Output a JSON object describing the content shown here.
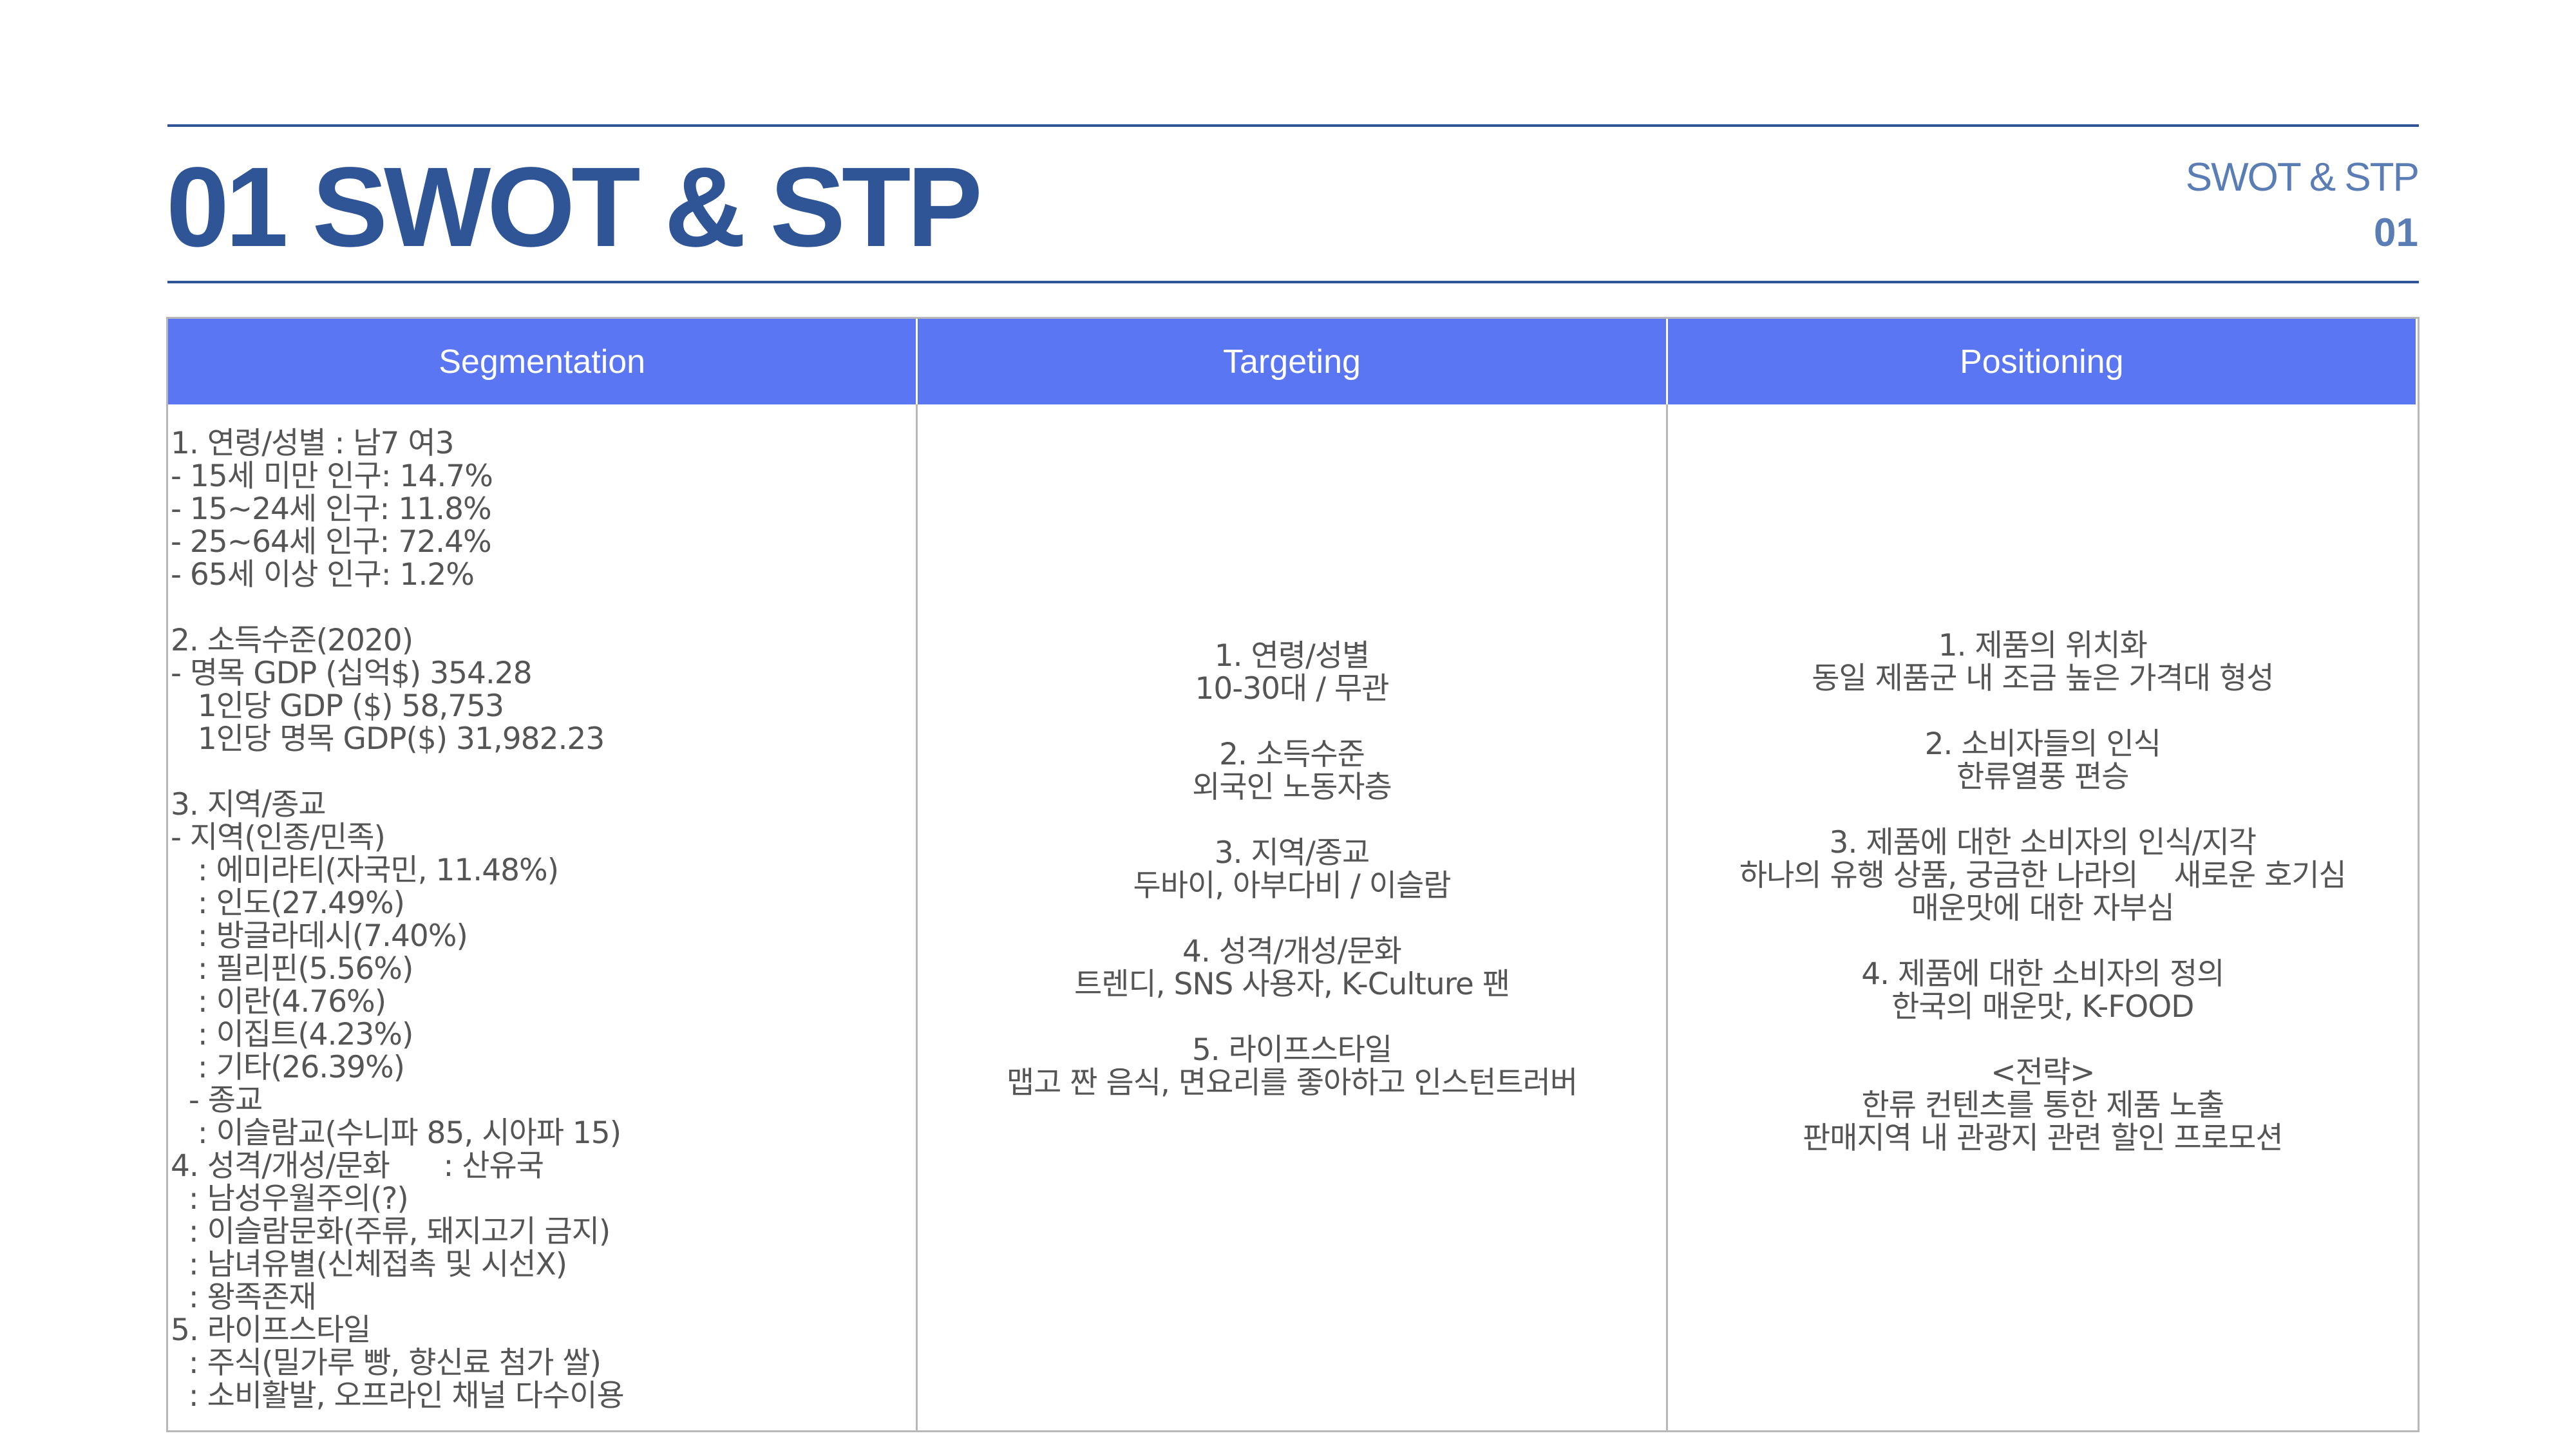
{
  "header": {
    "title": "01 SWOT & STP",
    "corner_label": "SWOT & STP",
    "corner_number": "01"
  },
  "table": {
    "headers": [
      "Segmentation",
      "Targeting",
      "Positioning"
    ],
    "segmentation": "1. 연령/성별 : 남7 여3\n- 15세 미만 인구: 14.7%\n- 15~24세 인구: 11.8%\n- 25~64세 인구: 72.4%\n- 65세 이상 인구: 1.2%\n\n2. 소득수준(2020)\n- 명목 GDP (십억$) 354.28\n   1인당 GDP ($) 58,753\n   1인당 명목 GDP($) 31,982.23\n\n3. 지역/종교\n- 지역(인종/민족)\n   : 에미라티(자국민, 11.48%)\n   : 인도(27.49%)\n   : 방글라데시(7.40%)\n   : 필리핀(5.56%)\n   : 이란(4.76%)\n   : 이집트(4.23%)\n   : 기타(26.39%)\n  - 종교\n   : 이슬람교(수니파 85, 시아파 15)\n4. 성격/개성/문화      : 산유국\n  : 남성우월주의(?)\n  : 이슬람문화(주류, 돼지고기 금지)\n  : 남녀유별(신체접촉 및 시선X)\n  : 왕족존재\n5. 라이프스타일\n  : 주식(밀가루 빵, 향신료 첨가 쌀)\n  : 소비활발, 오프라인 채널 다수이용",
    "targeting": "1. 연령/성별\n10-30대 / 무관\n\n2. 소득수준\n외국인 노동자층\n\n3. 지역/종교\n두바이, 아부다비 / 이슬람\n\n4. 성격/개성/문화\n트렌디, SNS 사용자, K-Culture 팬\n\n5. 라이프스타일\n맵고 짠 음식, 면요리를 좋아하고 인스턴트러버",
    "positioning": "1. 제품의 위치화\n동일 제품군 내 조금 높은 가격대 형성\n\n2. 소비자들의 인식\n한류열풍 편승\n\n3. 제품에 대한 소비자의 인식/지각\n하나의 유행 상품, 궁금한 나라의    새로운 호기심\n매운맛에 대한 자부심\n\n4. 제품에 대한 소비자의 정의\n한국의 매운맛, K-FOOD\n\n<전략>\n한류 컨텐츠를 통한 제품 노출\n판매지역 내 관광지 관련 할인 프로모션"
  },
  "colors": {
    "accent_blue": "#2f5597",
    "header_fill": "#5b76f2",
    "body_text": "#555555",
    "border": "#b8b8b8"
  }
}
